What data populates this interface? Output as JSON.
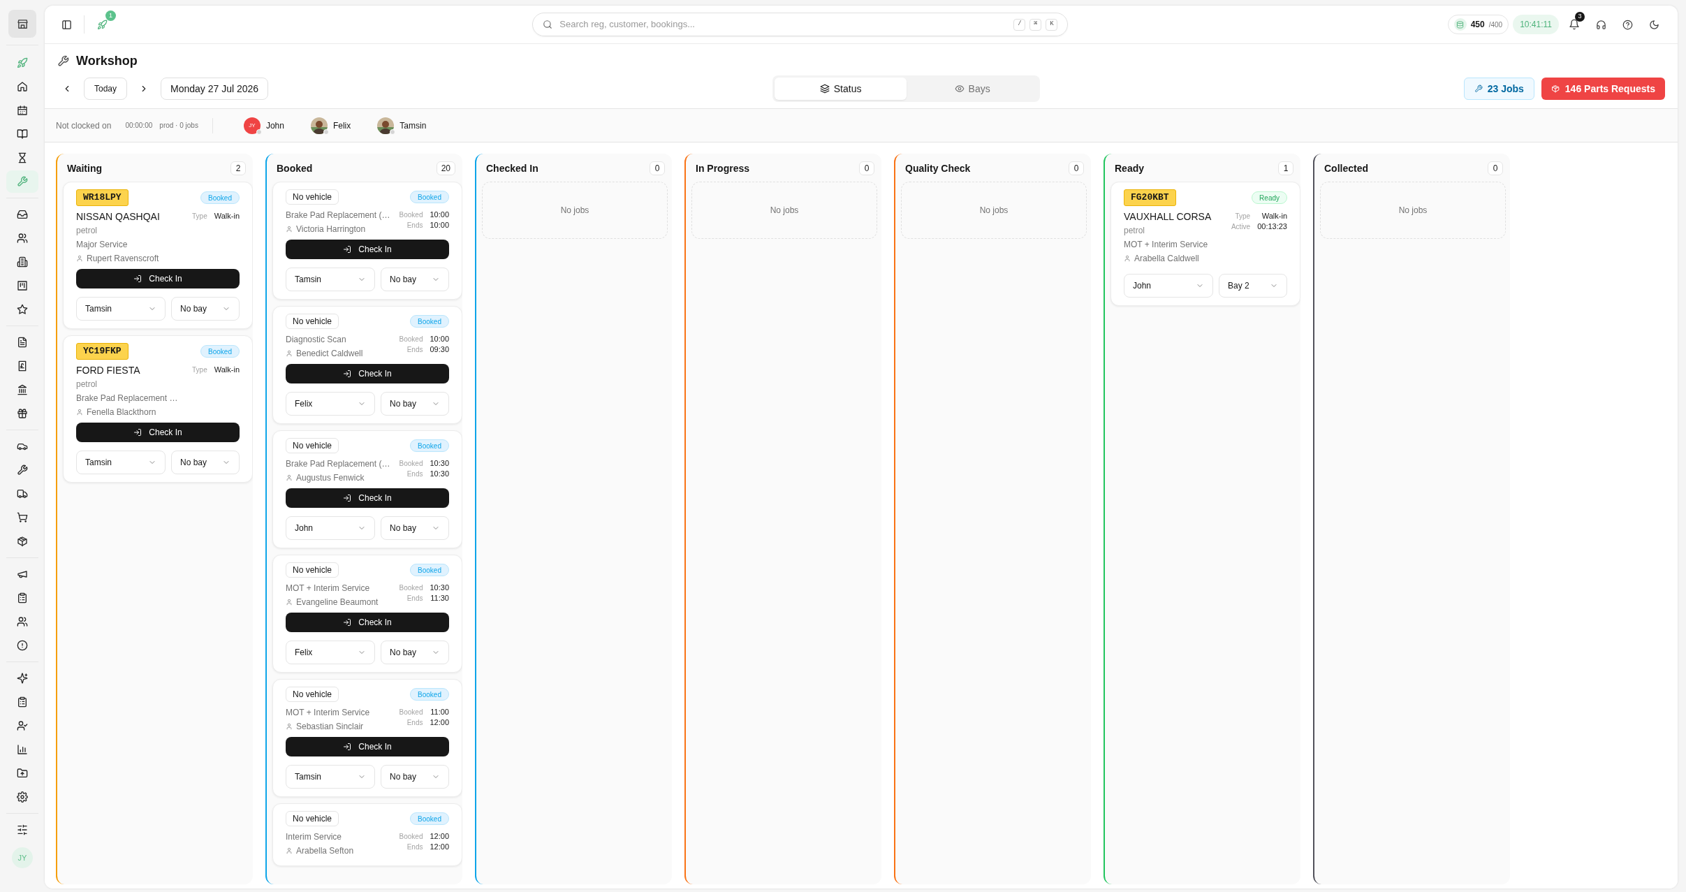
{
  "sidebar": {
    "items": [
      {
        "selected": false
      },
      {
        "selected": false
      },
      {
        "selected": false
      },
      {
        "selected": false
      },
      {
        "selected": false
      },
      {
        "selected": true
      },
      {
        "selected": false
      },
      {
        "selected": false
      },
      {
        "selected": false
      },
      {
        "selected": false
      },
      {
        "selected": false
      },
      {
        "selected": false
      },
      {
        "selected": false
      },
      {
        "selected": false
      },
      {
        "selected": false
      },
      {
        "selected": false
      },
      {
        "selected": false
      },
      {
        "selected": false
      },
      {
        "selected": false
      },
      {
        "selected": false
      },
      {
        "selected": false
      },
      {
        "selected": false
      },
      {
        "selected": false
      },
      {
        "selected": false
      },
      {
        "selected": false
      },
      {
        "selected": false
      },
      {
        "selected": false
      },
      {
        "selected": false
      },
      {
        "selected": false
      },
      {
        "selected": false
      },
      {
        "selected": false
      }
    ],
    "user_initials": "JY"
  },
  "topbar": {
    "launch_badge": "1",
    "search": {
      "placeholder": "Search reg, customer, bookings...",
      "shortcuts": [
        "/",
        "⌘",
        "K"
      ]
    },
    "credits": {
      "used": "450",
      "limit": "/400"
    },
    "clock": "10:41:11",
    "notifications": "3"
  },
  "page": {
    "title": "Workshop",
    "today": "Today",
    "date": "Monday 27 Jul 2026",
    "views": [
      {
        "label": "Status",
        "selected": true
      },
      {
        "label": "Bays",
        "selected": false
      }
    ],
    "jobs_button": "23 Jobs",
    "parts_button": "146 Parts Requests"
  },
  "clock_bar": {
    "status": "Not clocked on",
    "timer": "00:00:00",
    "summary": "prod · 0 jobs",
    "technicians": [
      {
        "name": "John",
        "kind": "initials",
        "initials": "JY",
        "color": "#ef4444",
        "online": false
      },
      {
        "name": "Felix",
        "kind": "picture",
        "online": false
      },
      {
        "name": "Tamsin",
        "kind": "picture",
        "online": false
      }
    ]
  },
  "columns": [
    {
      "title": "Waiting",
      "count": "2",
      "color": "#f59e0b",
      "jobs": [
        {
          "reg": "WR18LPY",
          "status": "Booked",
          "kind": "booked",
          "vehicle": "NISSAN QASHQAI",
          "fuel": "petrol",
          "service": "Major Service",
          "customer": "Rupert Ravenscroft",
          "meta": [
            {
              "label": "Type",
              "value": "Walk-in"
            }
          ],
          "action": "Check In",
          "technician": "Tamsin",
          "bay": "No bay"
        },
        {
          "reg": "YC19FKP",
          "status": "Booked",
          "kind": "booked",
          "vehicle": "FORD FIESTA",
          "fuel": "petrol",
          "service": "Brake Pad Replacement …",
          "customer": "Fenella Blackthorn",
          "meta": [
            {
              "label": "Type",
              "value": "Walk-in"
            }
          ],
          "action": "Check In",
          "technician": "Tamsin",
          "bay": "No bay"
        }
      ]
    },
    {
      "title": "Booked",
      "count": "20",
      "color": "#0ea5e9",
      "jobs": [
        {
          "no_vehicle": "No vehicle",
          "status": "Booked",
          "kind": "booked",
          "service": "Brake Pad Replacement (…",
          "customer": "Victoria Harrington",
          "meta": [
            {
              "label": "Booked",
              "value": "10:00"
            },
            {
              "label": "Ends",
              "value": "10:00"
            }
          ],
          "action": "Check In",
          "technician": "Tamsin",
          "bay": "No bay"
        },
        {
          "no_vehicle": "No vehicle",
          "status": "Booked",
          "kind": "booked",
          "service": "Diagnostic Scan",
          "customer": "Benedict Caldwell",
          "meta": [
            {
              "label": "Booked",
              "value": "10:00"
            },
            {
              "label": "Ends",
              "value": "09:30"
            }
          ],
          "action": "Check In",
          "technician": "Felix",
          "bay": "No bay"
        },
        {
          "no_vehicle": "No vehicle",
          "status": "Booked",
          "kind": "booked",
          "service": "Brake Pad Replacement (…",
          "customer": "Augustus Fenwick",
          "meta": [
            {
              "label": "Booked",
              "value": "10:30"
            },
            {
              "label": "Ends",
              "value": "10:30"
            }
          ],
          "action": "Check In",
          "technician": "John",
          "bay": "No bay"
        },
        {
          "no_vehicle": "No vehicle",
          "status": "Booked",
          "kind": "booked",
          "service": "MOT + Interim Service",
          "customer": "Evangeline Beaumont",
          "meta": [
            {
              "label": "Booked",
              "value": "10:30"
            },
            {
              "label": "Ends",
              "value": "11:30"
            }
          ],
          "action": "Check In",
          "technician": "Felix",
          "bay": "No bay"
        },
        {
          "no_vehicle": "No vehicle",
          "status": "Booked",
          "kind": "booked",
          "service": "MOT + Interim Service",
          "customer": "Sebastian Sinclair",
          "meta": [
            {
              "label": "Booked",
              "value": "11:00"
            },
            {
              "label": "Ends",
              "value": "12:00"
            }
          ],
          "action": "Check In",
          "technician": "Tamsin",
          "bay": "No bay"
        },
        {
          "no_vehicle": "No vehicle",
          "status": "Booked",
          "kind": "booked",
          "service": "Interim Service",
          "customer": "Arabella Sefton",
          "meta": [
            {
              "label": "Booked",
              "value": "12:00"
            },
            {
              "label": "Ends",
              "value": "12:00"
            }
          ]
        }
      ]
    },
    {
      "title": "Checked In",
      "count": "0",
      "color": "#0ea5e9",
      "empty_text": "No jobs"
    },
    {
      "title": "In Progress",
      "count": "0",
      "color": "#f97316",
      "empty_text": "No jobs"
    },
    {
      "title": "Quality Check",
      "count": "0",
      "color": "#f97316",
      "empty_text": "No jobs"
    },
    {
      "title": "Ready",
      "count": "1",
      "color": "#22c55e",
      "jobs": [
        {
          "reg": "FG20KBT",
          "status": "Ready",
          "kind": "ready",
          "vehicle": "VAUXHALL CORSA",
          "fuel": "petrol",
          "service": "MOT + Interim Service",
          "customer": "Arabella Caldwell",
          "meta": [
            {
              "label": "Type",
              "value": "Walk-in"
            },
            {
              "label": "Active",
              "value": "00:13:23"
            }
          ],
          "technician": "John",
          "bay": "Bay 2"
        }
      ]
    },
    {
      "title": "Collected",
      "count": "0",
      "color": "#52525b",
      "empty_text": "No jobs"
    }
  ]
}
